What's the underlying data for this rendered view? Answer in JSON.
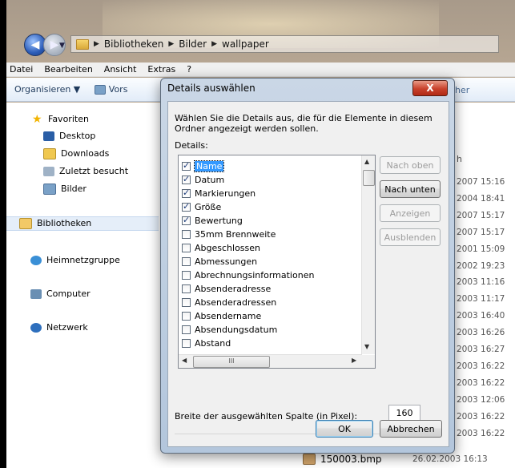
{
  "explorer": {
    "breadcrumb": [
      "Bibliotheken",
      "Bilder",
      "wallpaper"
    ],
    "menu": [
      "Datei",
      "Bearbeiten",
      "Ansicht",
      "Extras",
      "?"
    ],
    "toolbar": {
      "organize": "Organisieren ▼",
      "preview_fragment": "Vors",
      "right_fragment": "her"
    },
    "nav": {
      "favorites": "Favoriten",
      "desktop": "Desktop",
      "downloads": "Downloads",
      "recent": "Zuletzt besucht",
      "pictures": "Bilder",
      "libraries": "Bibliotheken",
      "homegroup": "Heimnetzgruppe",
      "computer": "Computer",
      "network": "Netzwerk"
    },
    "content_fragment": "h",
    "dates": [
      "2007 15:16",
      "2004 18:41",
      "2007 15:17",
      "2007 15:17",
      "2001 15:09",
      "2002 19:23",
      "2003 11:16",
      "2003 11:17",
      "2003 16:40",
      "2003 16:26",
      "2003 16:27",
      "2003 16:22",
      "2003 16:22",
      "2003 12:06",
      "2003 16:22",
      "2003 16:22"
    ],
    "last_file": {
      "name": "150003.bmp",
      "date": "26.02.2003 16:13"
    }
  },
  "dialog": {
    "title": "Details auswählen",
    "close_label": "X",
    "description": "Wählen Sie die Details aus, die für die Elemente in diesem Ordner angezeigt werden sollen.",
    "details_label": "Details:",
    "items": [
      {
        "label": "Name",
        "checked": true,
        "selected": true
      },
      {
        "label": "Datum",
        "checked": true
      },
      {
        "label": "Markierungen",
        "checked": true
      },
      {
        "label": "Größe",
        "checked": true
      },
      {
        "label": "Bewertung",
        "checked": true
      },
      {
        "label": "35mm Brennweite",
        "checked": false
      },
      {
        "label": "Abgeschlossen",
        "checked": false
      },
      {
        "label": "Abmessungen",
        "checked": false
      },
      {
        "label": "Abrechnungsinformationen",
        "checked": false
      },
      {
        "label": "Absenderadresse",
        "checked": false
      },
      {
        "label": "Absenderadressen",
        "checked": false
      },
      {
        "label": "Absendername",
        "checked": false
      },
      {
        "label": "Absendungsdatum",
        "checked": false
      },
      {
        "label": "Abstand",
        "checked": false
      }
    ],
    "hscroll_thumb": "III",
    "buttons": {
      "move_up": "Nach oben",
      "move_down": "Nach unten",
      "show": "Anzeigen",
      "hide": "Ausblenden",
      "ok": "OK",
      "cancel": "Abbrechen"
    },
    "width_label": "Breite der ausgewählten Spalte (in Pixel):",
    "width_value": "160"
  }
}
